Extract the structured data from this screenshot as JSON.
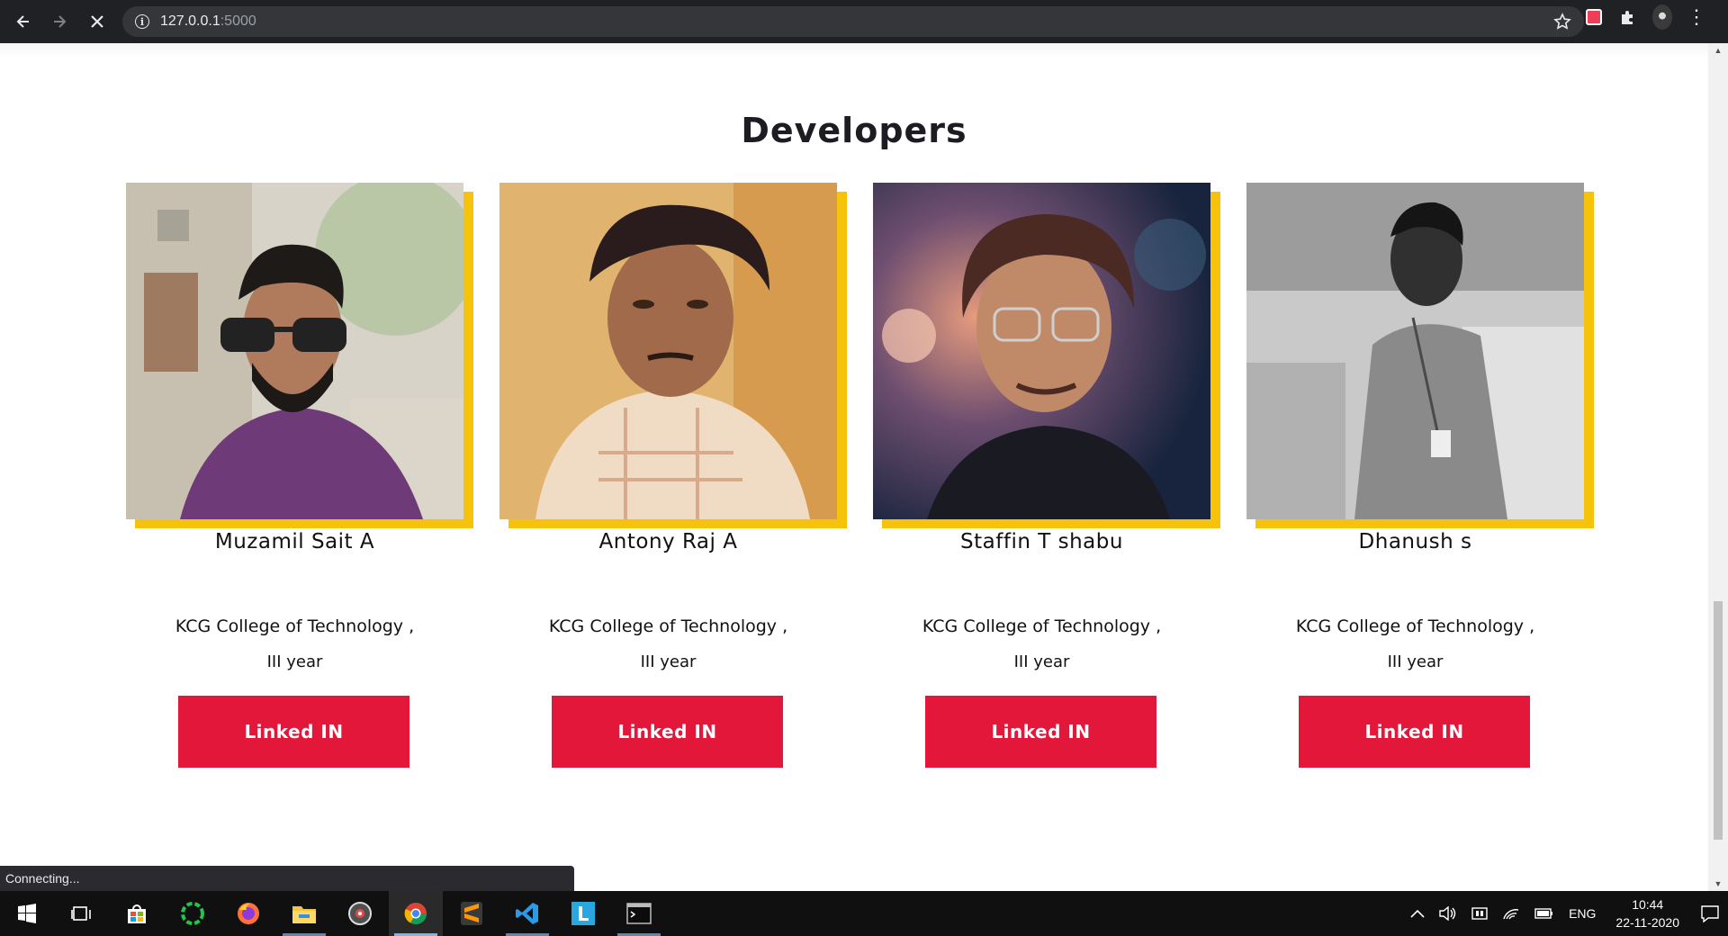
{
  "browser": {
    "url_host": "127.0.0.1",
    "url_port": ":5000",
    "status_text": "Connecting..."
  },
  "section": {
    "title": "Developers"
  },
  "developers": [
    {
      "name": "Muzamil Sait A",
      "college": "KCG College of Technology ,",
      "year": "III year",
      "button": "Linked IN"
    },
    {
      "name": "Antony Raj A",
      "college": "KCG College of Technology ,",
      "year": "III year",
      "button": "Linked IN"
    },
    {
      "name": "Staffin T shabu",
      "college": "KCG College of Technology ,",
      "year": "III year",
      "button": "Linked IN"
    },
    {
      "name": "Dhanush s",
      "college": "KCG College of Technology ,",
      "year": "III year",
      "button": "Linked IN"
    }
  ],
  "taskbar": {
    "language": "ENG",
    "time": "10:44",
    "date": "22-11-2020",
    "apps": [
      "start-icon",
      "task-view-icon",
      "store-icon",
      "loader-app-icon",
      "firefox-icon",
      "file-explorer-icon",
      "media-player-icon",
      "chrome-icon",
      "sublime-icon",
      "vscode-icon",
      "l-app-icon",
      "terminal-icon"
    ]
  },
  "colors": {
    "accent_yellow": "#f6c20a",
    "button_red": "#e2173a",
    "browser_dark": "#202124"
  }
}
